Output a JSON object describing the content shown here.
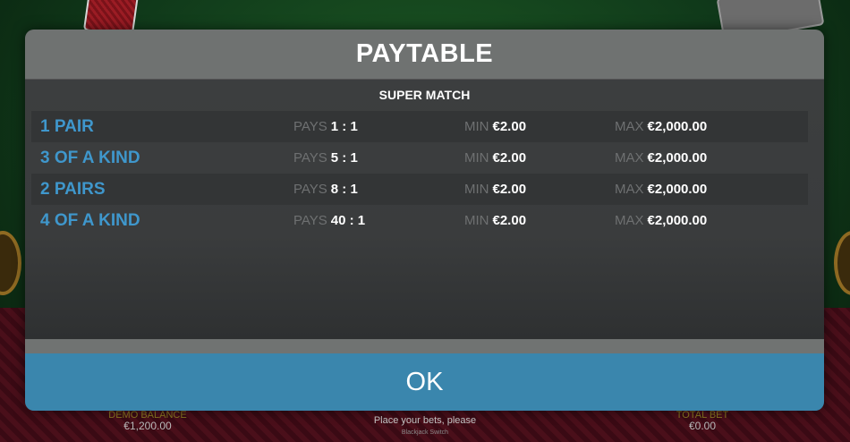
{
  "modal": {
    "title": "PAYTABLE",
    "section_title": "SUPER MATCH",
    "pays_label": "PAYS",
    "min_label": "MIN",
    "max_label": "MAX",
    "rows": [
      {
        "hand": "1 PAIR",
        "pays": "1 : 1",
        "min": "€2.00",
        "max": "€2,000.00"
      },
      {
        "hand": "3 OF A KIND",
        "pays": "5 : 1",
        "min": "€2.00",
        "max": "€2,000.00"
      },
      {
        "hand": "2 PAIRS",
        "pays": "8 : 1",
        "min": "€2.00",
        "max": "€2,000.00"
      },
      {
        "hand": "4 OF A KIND",
        "pays": "40 : 1",
        "min": "€2.00",
        "max": "€2,000.00"
      }
    ],
    "ok_label": "OK"
  },
  "hud": {
    "balance_label": "DEMO BALANCE",
    "balance_value": "€1,200.00",
    "status_text": "Place your bets, please",
    "game_name": "Blackjack Switch",
    "total_bet_label": "TOTAL BET",
    "total_bet_value": "€0.00"
  },
  "colors": {
    "hand_name": "#3f97cc",
    "ok_button": "#3a86ad",
    "header": "#6f7271"
  }
}
